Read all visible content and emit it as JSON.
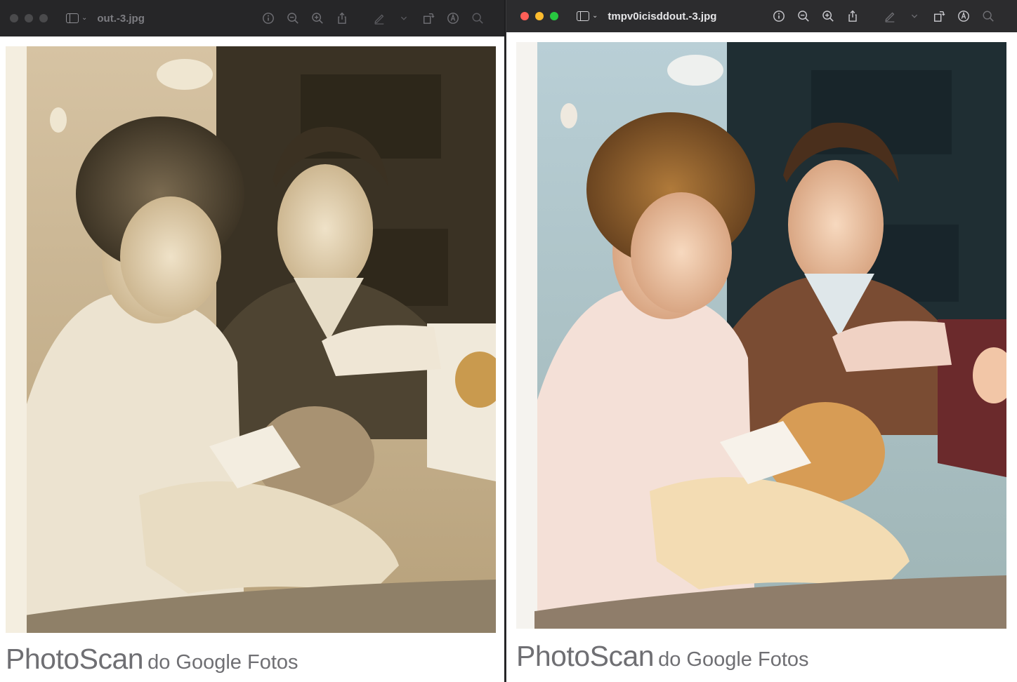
{
  "windows": [
    {
      "title": "out.-3.jpg",
      "caption": {
        "brand": "PhotoScan",
        "rest": "do Google Fotos"
      },
      "style": "sepia"
    },
    {
      "title": "tmpv0icisddout.-3.jpg",
      "caption": {
        "brand": "PhotoScan",
        "rest": "do Google Fotos"
      },
      "style": "colorized"
    }
  ],
  "toolbar_icons": [
    "info-icon",
    "zoom-out-icon",
    "zoom-in-icon",
    "share-icon",
    "markup-icon",
    "chevron-down-icon",
    "rotate-icon",
    "annotate-icon",
    "search-icon"
  ]
}
